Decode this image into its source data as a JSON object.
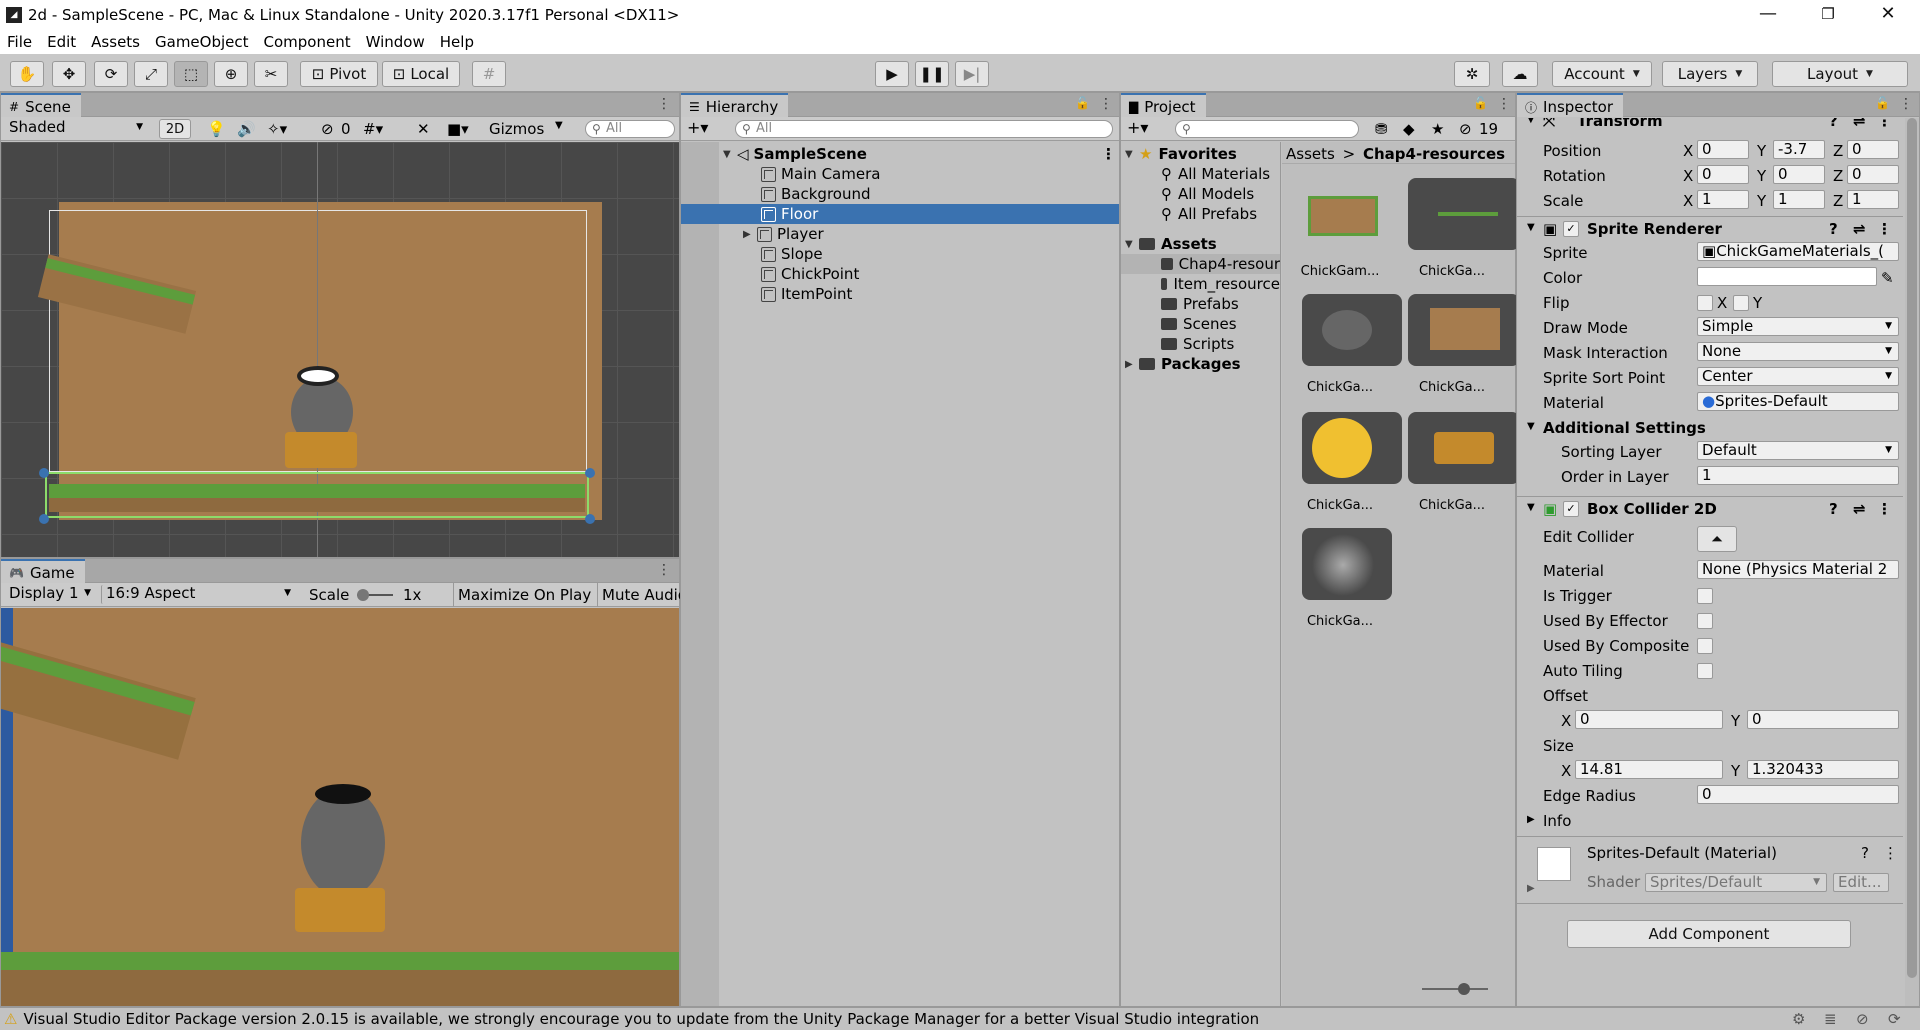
{
  "window": {
    "title": "2d - SampleScene - PC, Mac & Linux Standalone - Unity 2020.3.17f1 Personal <DX11>",
    "minimize": "—",
    "restore": "❐",
    "close": "✕"
  },
  "menu": [
    "File",
    "Edit",
    "Assets",
    "GameObject",
    "Component",
    "Window",
    "Help"
  ],
  "toolbar": {
    "pivot": "Pivot",
    "local": "Local",
    "account": "Account",
    "layers": "Layers",
    "layout": "Layout"
  },
  "scene": {
    "tab": "Scene",
    "shading": "Shaded",
    "mode_2d": "2D",
    "hidden_count": "0",
    "gizmos": "Gizmos",
    "search_placeholder": "All"
  },
  "game": {
    "tab": "Game",
    "display": "Display 1",
    "aspect": "16:9 Aspect",
    "scale_label": "Scale",
    "scale_value": "1x",
    "maximize": "Maximize On Play",
    "mute": "Mute Audio"
  },
  "hierarchy": {
    "tab": "Hierarchy",
    "search_placeholder": "All",
    "scene_name": "SampleScene",
    "items": [
      {
        "label": "Main Camera",
        "selected": false,
        "expandable": false
      },
      {
        "label": "Background",
        "selected": false,
        "expandable": false
      },
      {
        "label": "Floor",
        "selected": true,
        "expandable": false
      },
      {
        "label": "Player",
        "selected": false,
        "expandable": true
      },
      {
        "label": "Slope",
        "selected": false,
        "expandable": false
      },
      {
        "label": "ChickPoint",
        "selected": false,
        "expandable": false
      },
      {
        "label": "ItemPoint",
        "selected": false,
        "expandable": false
      }
    ]
  },
  "project": {
    "tab": "Project",
    "hidden_count": "19",
    "favorites_label": "Favorites",
    "favorites": [
      "All Materials",
      "All Models",
      "All Prefabs"
    ],
    "assets_label": "Assets",
    "assets": [
      "Chap4-resour",
      "Item_resource",
      "Prefabs",
      "Scenes",
      "Scripts"
    ],
    "packages_label": "Packages",
    "breadcrumb_root": "Assets",
    "breadcrumb_sep": ">",
    "breadcrumb_current": "Chap4-resources",
    "thumbnails": [
      "ChickGam...",
      "ChickGa...",
      "ChickGa...",
      "ChickGa...",
      "ChickGa...",
      "ChickGa...",
      "ChickGa..."
    ]
  },
  "inspector": {
    "tab": "Inspector",
    "transform": {
      "title": "Transform",
      "position_label": "Position",
      "position": {
        "x": "0",
        "y": "-3.7",
        "z": "0"
      },
      "rotation_label": "Rotation",
      "rotation": {
        "x": "0",
        "y": "0",
        "z": "0"
      },
      "scale_label": "Scale",
      "scale": {
        "x": "1",
        "y": "1",
        "z": "1"
      }
    },
    "sprite_renderer": {
      "title": "Sprite Renderer",
      "sprite_label": "Sprite",
      "sprite": "ChickGameMaterials_(",
      "color_label": "Color",
      "flip_label": "Flip",
      "flip_x": "X",
      "flip_y": "Y",
      "draw_mode_label": "Draw Mode",
      "draw_mode": "Simple",
      "mask_label": "Mask Interaction",
      "mask": "None",
      "sort_point_label": "Sprite Sort Point",
      "sort_point": "Center",
      "material_label": "Material",
      "material": "Sprites-Default",
      "additional_label": "Additional Settings",
      "sorting_layer_label": "Sorting Layer",
      "sorting_layer": "Default",
      "order_label": "Order in Layer",
      "order": "1"
    },
    "box_collider": {
      "title": "Box Collider 2D",
      "edit_label": "Edit Collider",
      "material_label": "Material",
      "material": "None (Physics Material 2",
      "trigger_label": "Is Trigger",
      "effector_label": "Used By Effector",
      "composite_label": "Used By Composite",
      "tiling_label": "Auto Tiling",
      "offset_label": "Offset",
      "offset": {
        "x": "0",
        "y": "0"
      },
      "size_label": "Size",
      "size": {
        "x": "14.81",
        "y": "1.320433"
      },
      "edge_label": "Edge Radius",
      "edge": "0",
      "info_label": "Info"
    },
    "material_block": {
      "title": "Sprites-Default (Material)",
      "shader_label": "Shader",
      "shader": "Sprites/Default",
      "edit": "Edit..."
    },
    "add_component": "Add Component"
  },
  "status": {
    "message": "Visual Studio Editor Package version 2.0.15 is available, we strongly encourage you to update from the Unity Package Manager for a better Visual Studio integration"
  },
  "colors": {
    "selection": "#3a72b0",
    "panel": "#c2c2c2",
    "grass": "#5d9d3c",
    "dirt": "#a67c4e"
  }
}
